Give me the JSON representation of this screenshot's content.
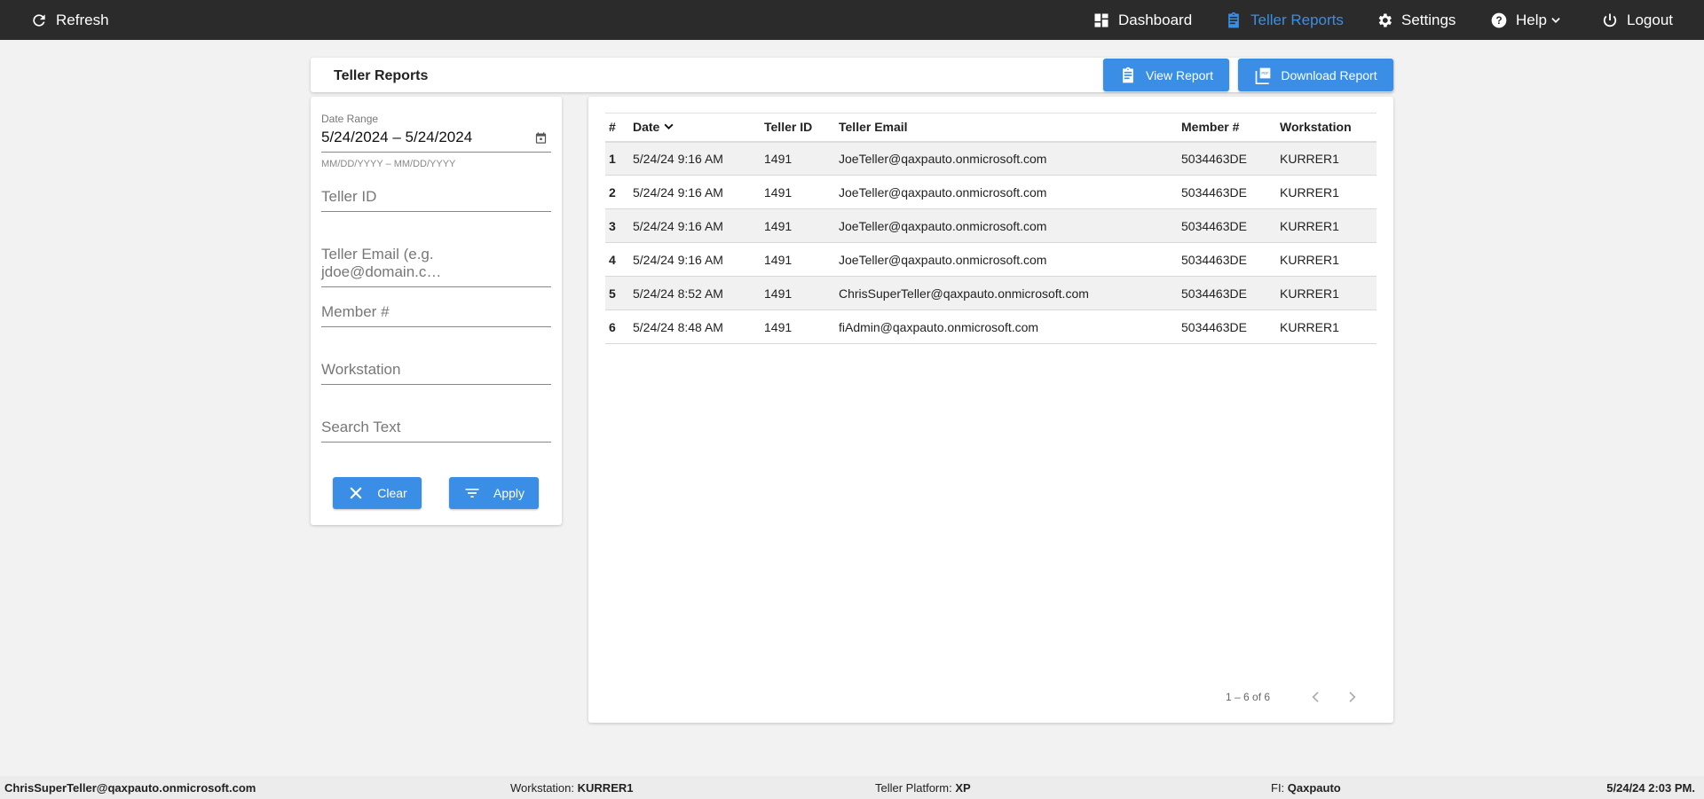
{
  "topbar": {
    "refresh": "Refresh",
    "nav": [
      {
        "label": "Dashboard",
        "icon": "dashboard-icon"
      },
      {
        "label": "Teller Reports",
        "icon": "clipboard-icon",
        "active": true
      },
      {
        "label": "Settings",
        "icon": "gear-icon"
      },
      {
        "label": "Help",
        "icon": "help-icon"
      },
      {
        "label": "Logout",
        "icon": "power-icon"
      }
    ]
  },
  "colors": {
    "accent": "#3a8ee6",
    "topbar": "#2b2b2b"
  },
  "header": {
    "title": "Teller Reports",
    "view_report": "View Report",
    "download_report": "Download Report"
  },
  "filters": {
    "date_label": "Date Range",
    "date_value": "5/24/2024 – 5/24/2024",
    "date_hint": "MM/DD/YYYY – MM/DD/YYYY",
    "teller_id": "Teller ID",
    "teller_email": "Teller Email (e.g. jdoe@domain.c…",
    "member": "Member #",
    "workstation": "Workstation",
    "search": "Search Text",
    "clear": "Clear",
    "apply": "Apply"
  },
  "table": {
    "columns": [
      "#",
      "Date",
      "Teller ID",
      "Teller Email",
      "Member #",
      "Workstation"
    ],
    "rows": [
      [
        "1",
        "5/24/24 9:16 AM",
        "1491",
        "JoeTeller@qaxpauto.onmicrosoft.com",
        "5034463DE",
        "KURRER1"
      ],
      [
        "2",
        "5/24/24 9:16 AM",
        "1491",
        "JoeTeller@qaxpauto.onmicrosoft.com",
        "5034463DE",
        "KURRER1"
      ],
      [
        "3",
        "5/24/24 9:16 AM",
        "1491",
        "JoeTeller@qaxpauto.onmicrosoft.com",
        "5034463DE",
        "KURRER1"
      ],
      [
        "4",
        "5/24/24 9:16 AM",
        "1491",
        "JoeTeller@qaxpauto.onmicrosoft.com",
        "5034463DE",
        "KURRER1"
      ],
      [
        "5",
        "5/24/24 8:52 AM",
        "1491",
        "ChrisSuperTeller@qaxpauto.onmicrosoft.com",
        "5034463DE",
        "KURRER1"
      ],
      [
        "6",
        "5/24/24 8:48 AM",
        "1491",
        "fiAdmin@qaxpauto.onmicrosoft.com",
        "5034463DE",
        "KURRER1"
      ]
    ],
    "range": "1 – 6 of 6"
  },
  "footer": {
    "user": "ChrisSuperTeller@qaxpauto.onmicrosoft.com",
    "workstation_label": "Workstation:",
    "workstation": "KURRER1",
    "platform_label": "Teller Platform:",
    "platform": "XP",
    "fi_label": "FI:",
    "fi": "Qaxpauto",
    "datetime": "5/24/24 2:03 PM."
  }
}
